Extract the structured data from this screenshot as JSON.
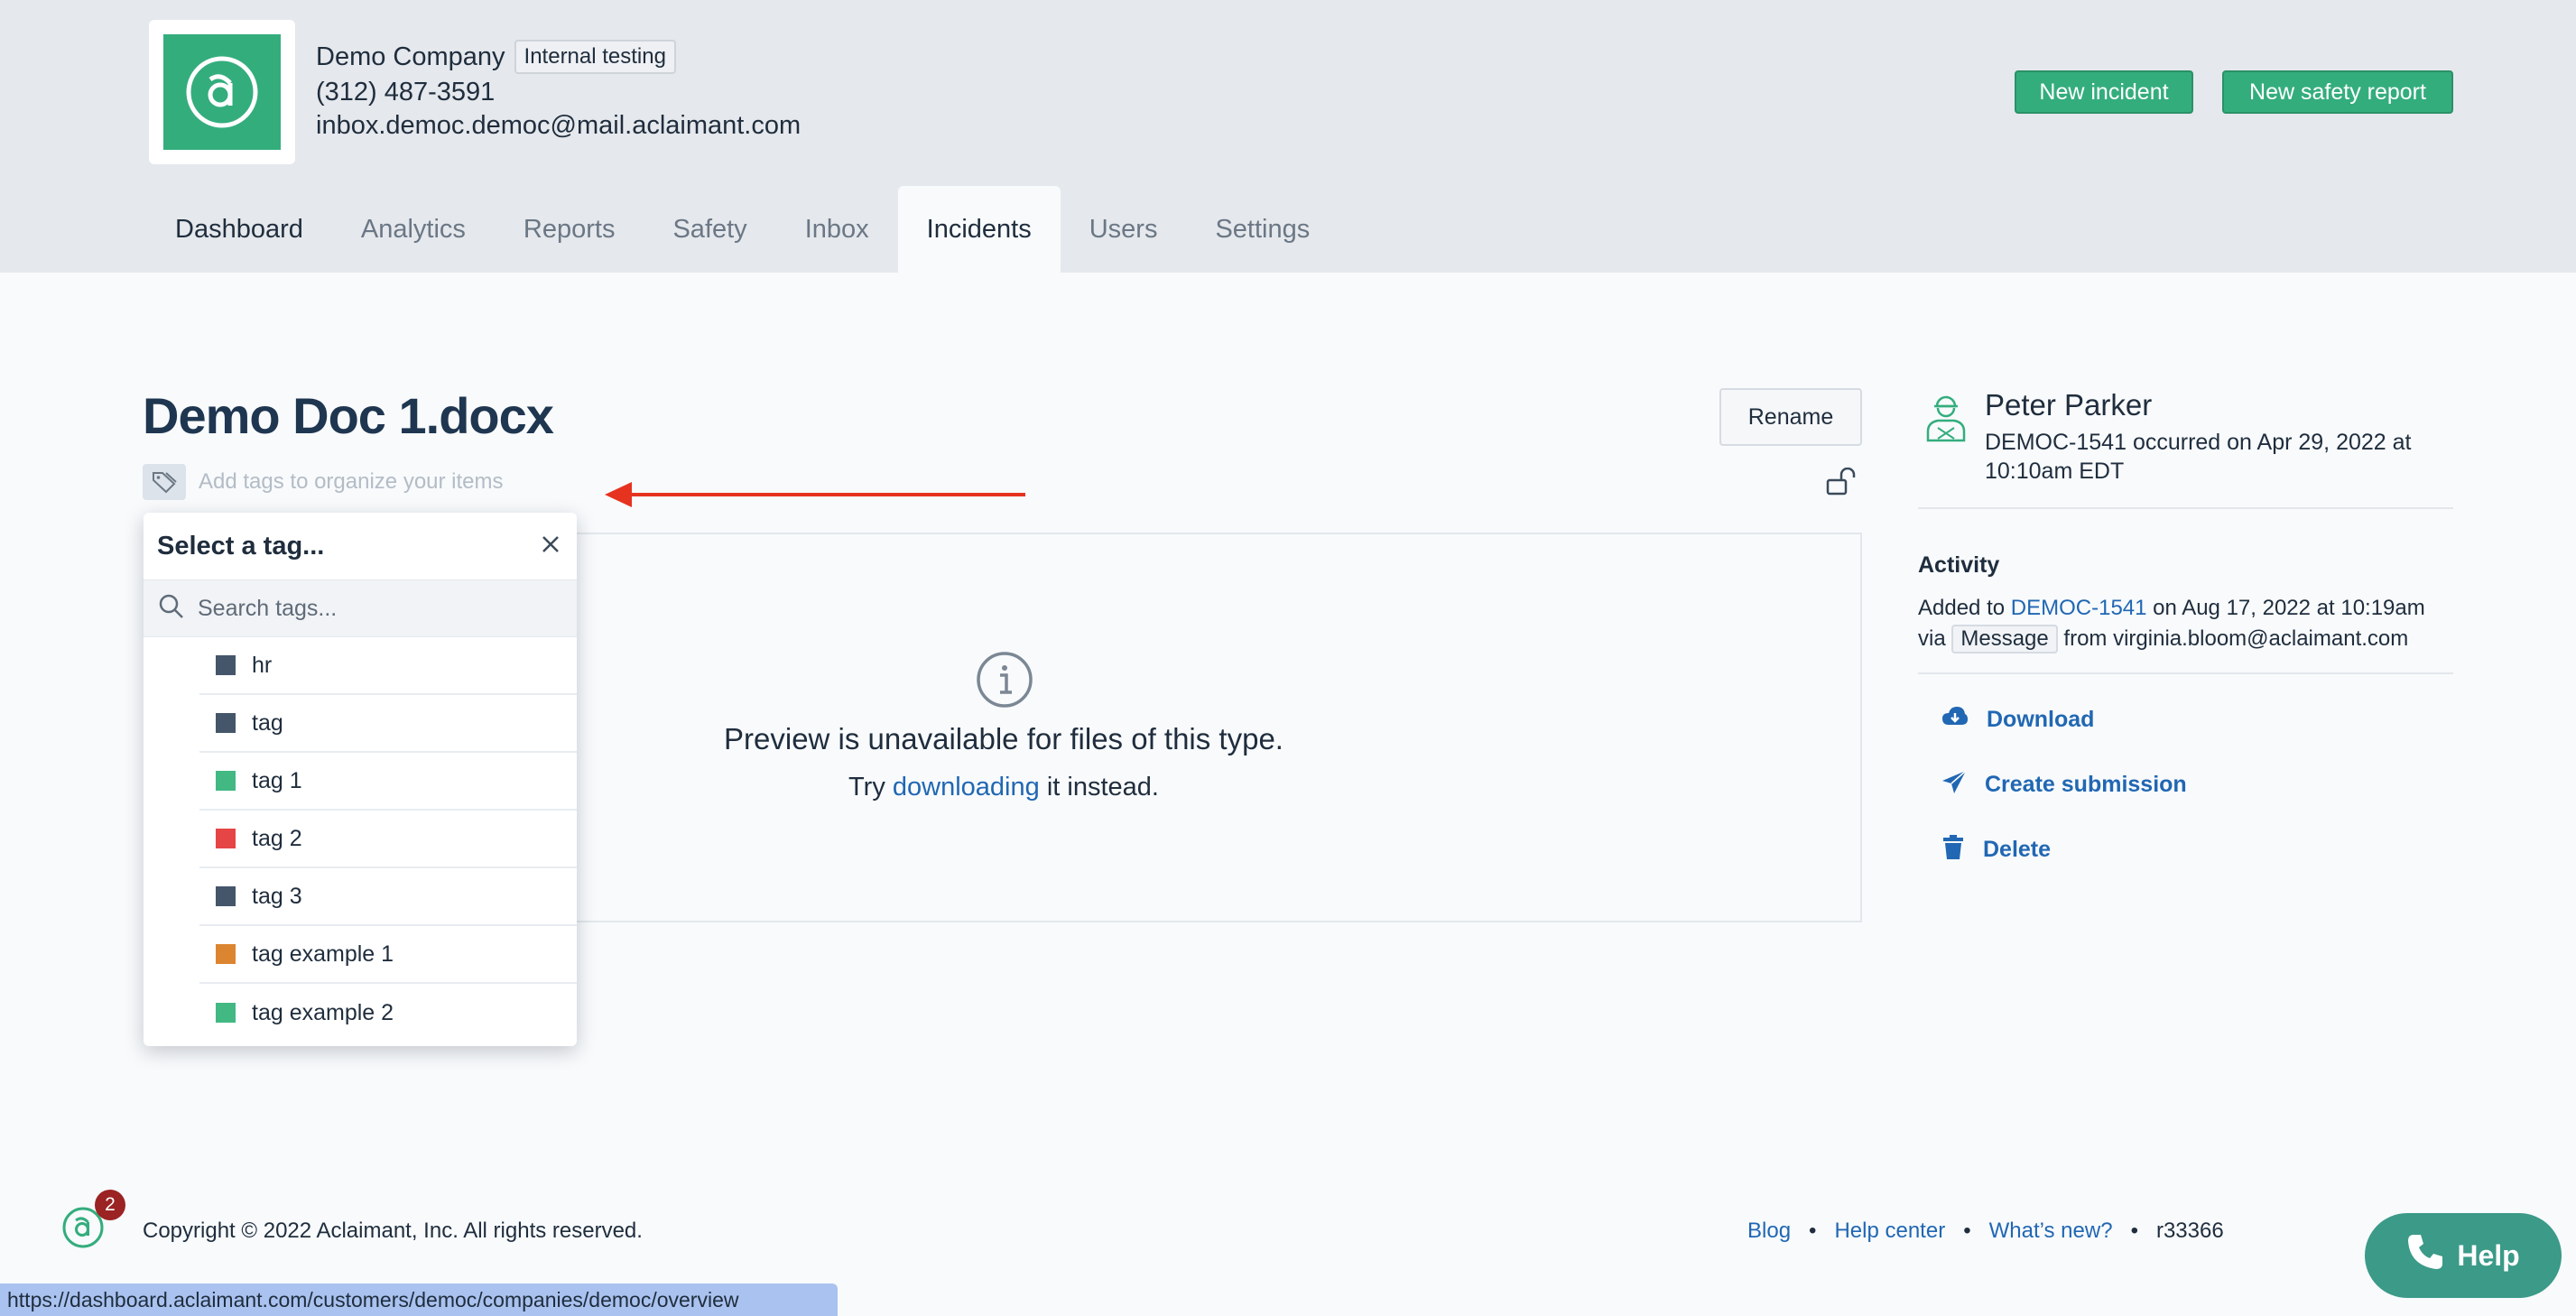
{
  "header": {
    "company_name": "Demo Company",
    "company_badge": "Internal testing",
    "phone": "(312) 487-3591",
    "email": "inbox.democ.democ@mail.aclaimant.com",
    "new_incident_label": "New incident",
    "new_safety_report_label": "New safety report",
    "brand_color": "#34ad7d"
  },
  "nav": {
    "tabs": [
      {
        "label": "Dashboard"
      },
      {
        "label": "Analytics"
      },
      {
        "label": "Reports"
      },
      {
        "label": "Safety"
      },
      {
        "label": "Inbox"
      },
      {
        "label": "Incidents",
        "active": true
      },
      {
        "label": "Users"
      },
      {
        "label": "Settings"
      }
    ]
  },
  "document": {
    "title": "Demo Doc 1.docx",
    "tags_placeholder": "Add tags to organize your items",
    "rename_label": "Rename",
    "preview_title": "Preview is unavailable for files of this type.",
    "preview_try": "Try",
    "preview_link": "downloading",
    "preview_rest": "it instead."
  },
  "tag_dropdown": {
    "title": "Select a tag...",
    "search_placeholder": "Search tags...",
    "items": [
      {
        "label": "hr",
        "color": "#45566b"
      },
      {
        "label": "tag",
        "color": "#45566b"
      },
      {
        "label": "tag 1",
        "color": "#42b883"
      },
      {
        "label": "tag 2",
        "color": "#e64545"
      },
      {
        "label": "tag 3",
        "color": "#45566b"
      },
      {
        "label": "tag example 1",
        "color": "#dc8530"
      },
      {
        "label": "tag example 2",
        "color": "#42b883"
      }
    ]
  },
  "sidebar": {
    "person_name": "Peter Parker",
    "person_sub": "DEMOC-1541 occurred on Apr 29, 2022 at 10:10am EDT",
    "activity_heading": "Activity",
    "activity_added_to": "Added to",
    "activity_link": "DEMOC-1541",
    "activity_on": "on Aug 17, 2022 at 10:19am",
    "activity_via": "via",
    "activity_via_badge": "Message",
    "activity_from": "from virginia.bloom@aclaimant.com",
    "actions": [
      {
        "label": "Download",
        "icon": "cloud-download-icon"
      },
      {
        "label": "Create submission",
        "icon": "send-icon"
      },
      {
        "label": "Delete",
        "icon": "trash-icon"
      }
    ]
  },
  "footer": {
    "notification_count": "2",
    "copyright": "Copyright © 2022 Aclaimant, Inc. All rights reserved.",
    "blog": "Blog",
    "help_center": "Help center",
    "whats_new": "What’s new?",
    "version": "r33366",
    "help_button": "Help",
    "status_url": "https://dashboard.aclaimant.com/customers/democ/companies/democ/overview"
  }
}
